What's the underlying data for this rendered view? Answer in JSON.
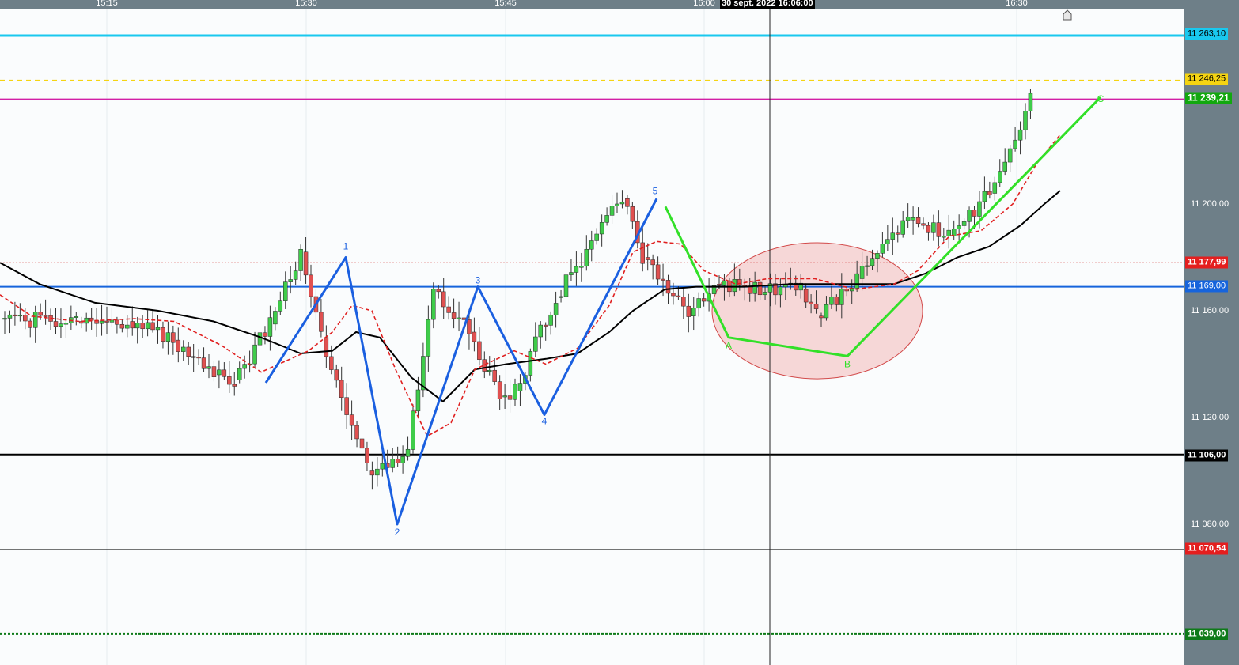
{
  "timebar": {
    "labels": [
      "15:15",
      "15:30",
      "15:45",
      "16:00",
      "16:30"
    ],
    "crosshair_time": "30 sept. 2022 16:06:00"
  },
  "axis": {
    "ticks": [
      "11 200,00",
      "11 160,00",
      "11 120,00",
      "11 080,00"
    ]
  },
  "levels": [
    {
      "label": "11 263,10",
      "value": 11263.1,
      "color": "#19c8ee",
      "label_bg": "#19c8ee",
      "label_fg": "#000000",
      "style": "solid"
    },
    {
      "label": "11 246,25",
      "value": 11246.25,
      "color": "#f5d412",
      "label_bg": "#f5d412",
      "label_fg": "#000000",
      "style": "dashed"
    },
    {
      "label": "11 239,21",
      "value": 11239.21,
      "color": "#d21fa5",
      "label_bg": "#11a80e",
      "label_fg": "#ffffff",
      "style": "solid"
    },
    {
      "label": "11 177,99",
      "value": 11177.99,
      "color": "#d23a3a",
      "label_bg": "#e41e1e",
      "label_fg": "#ffffff",
      "style": "dotted"
    },
    {
      "label": "11 169,00",
      "value": 11169.0,
      "color": "#1664dc",
      "label_bg": "#1664dc",
      "label_fg": "#ffffff",
      "style": "solid"
    },
    {
      "label": "11 106,00",
      "value": 11106.0,
      "color": "#000000",
      "label_bg": "#000000",
      "label_fg": "#ffffff",
      "style": "solid"
    },
    {
      "label": "11 070,54",
      "value": 11070.54,
      "color": "#222222",
      "label_bg": "#e41e1e",
      "label_fg": "#ffffff",
      "style": "thin"
    },
    {
      "label": "11 039,00",
      "value": 11039.0,
      "color": "#0e7a19",
      "label_bg": "#0e7a19",
      "label_fg": "#ffffff",
      "style": "dotted"
    }
  ],
  "wave_labels": {
    "blue": [
      "1",
      "2",
      "3",
      "4",
      "5"
    ],
    "green": [
      "A",
      "B",
      "C"
    ]
  },
  "colors": {
    "up_candle": "#3fcc4a",
    "down_candle": "#e05050",
    "blue_wave": "#1a5fe0",
    "green_wave": "#32e028",
    "sma_fast": "#e02020",
    "sma_slow": "#000000",
    "ellipse_fill": "#f2b8b8",
    "ellipse_stroke": "#d24a4a"
  },
  "chart_data": {
    "type": "candlestick",
    "ylim": [
      11022,
      11285
    ],
    "x_axis_ticks": [
      "15:15",
      "15:30",
      "15:45",
      "16:00",
      "16:30"
    ],
    "y_axis_ticks": [
      11200,
      11160,
      11120,
      11080
    ],
    "segments": [
      {
        "from": 11157,
        "to": 11156,
        "n": 15,
        "seed": 1
      },
      {
        "from": 11156,
        "to": 11156,
        "n": 10,
        "seed": 2
      },
      {
        "from": 11156,
        "to": 11149,
        "n": 9,
        "seed": 3
      },
      {
        "from": 11149,
        "to": 11136,
        "n": 8,
        "seed": 4
      },
      {
        "from": 11136,
        "to": 11134,
        "n": 4,
        "seed": 5
      },
      {
        "from": 11134,
        "to": 11155,
        "n": 7,
        "seed": 6
      },
      {
        "from": 11155,
        "to": 11182,
        "n": 6,
        "seed": 7
      },
      {
        "from": 11182,
        "to": 11150,
        "n": 4,
        "seed": 8
      },
      {
        "from": 11150,
        "to": 11100,
        "n": 9,
        "seed": 9
      },
      {
        "from": 11100,
        "to": 11108,
        "n": 8,
        "seed": 10
      },
      {
        "from": 11108,
        "to": 11168,
        "n": 5,
        "seed": 11
      },
      {
        "from": 11168,
        "to": 11152,
        "n": 7,
        "seed": 12
      },
      {
        "from": 11152,
        "to": 11128,
        "n": 6,
        "seed": 13
      },
      {
        "from": 11128,
        "to": 11130,
        "n": 3,
        "seed": 14
      },
      {
        "from": 11130,
        "to": 11165,
        "n": 8,
        "seed": 15
      },
      {
        "from": 11165,
        "to": 11202,
        "n": 13,
        "seed": 16
      },
      {
        "from": 11202,
        "to": 11180,
        "n": 4,
        "seed": 17
      },
      {
        "from": 11180,
        "to": 11158,
        "n": 9,
        "seed": 18
      },
      {
        "from": 11158,
        "to": 11170,
        "n": 5,
        "seed": 19
      },
      {
        "from": 11170,
        "to": 11168,
        "n": 17,
        "seed": 20
      },
      {
        "from": 11168,
        "to": 11158,
        "n": 3,
        "seed": 21
      },
      {
        "from": 11158,
        "to": 11172,
        "n": 8,
        "seed": 22
      },
      {
        "from": 11172,
        "to": 11194,
        "n": 10,
        "seed": 23
      },
      {
        "from": 11194,
        "to": 11188,
        "n": 8,
        "seed": 24
      },
      {
        "from": 11188,
        "to": 11204,
        "n": 8,
        "seed": 25
      },
      {
        "from": 11204,
        "to": 11239,
        "n": 8,
        "seed": 26
      }
    ],
    "sma_fast": [
      [
        0,
        11166
      ],
      [
        40,
        11158
      ],
      [
        100,
        11156
      ],
      [
        170,
        11157
      ],
      [
        220,
        11156
      ],
      [
        280,
        11147
      ],
      [
        330,
        11137
      ],
      [
        390,
        11145
      ],
      [
        420,
        11152
      ],
      [
        445,
        11162
      ],
      [
        470,
        11160
      ],
      [
        500,
        11138
      ],
      [
        540,
        11113
      ],
      [
        570,
        11118
      ],
      [
        600,
        11138
      ],
      [
        650,
        11145
      ],
      [
        690,
        11140
      ],
      [
        730,
        11146
      ],
      [
        770,
        11162
      ],
      [
        800,
        11182
      ],
      [
        830,
        11186
      ],
      [
        860,
        11185
      ],
      [
        890,
        11175
      ],
      [
        930,
        11170
      ],
      [
        970,
        11172
      ],
      [
        1030,
        11172
      ],
      [
        1080,
        11168
      ],
      [
        1130,
        11170
      ],
      [
        1160,
        11175
      ],
      [
        1200,
        11188
      ],
      [
        1240,
        11190
      ],
      [
        1280,
        11200
      ],
      [
        1310,
        11215
      ],
      [
        1340,
        11226
      ]
    ],
    "sma_slow": [
      [
        0,
        11178
      ],
      [
        50,
        11170
      ],
      [
        120,
        11163
      ],
      [
        200,
        11160
      ],
      [
        270,
        11156
      ],
      [
        330,
        11150
      ],
      [
        380,
        11144
      ],
      [
        420,
        11145
      ],
      [
        450,
        11152
      ],
      [
        480,
        11150
      ],
      [
        520,
        11135
      ],
      [
        560,
        11126
      ],
      [
        600,
        11138
      ],
      [
        640,
        11140
      ],
      [
        690,
        11142
      ],
      [
        730,
        11144
      ],
      [
        770,
        11152
      ],
      [
        800,
        11160
      ],
      [
        840,
        11168
      ],
      [
        880,
        11169
      ],
      [
        940,
        11169
      ],
      [
        1000,
        11170
      ],
      [
        1060,
        11170
      ],
      [
        1130,
        11170
      ],
      [
        1170,
        11174
      ],
      [
        1210,
        11180
      ],
      [
        1250,
        11184
      ],
      [
        1290,
        11192
      ],
      [
        1320,
        11200
      ],
      [
        1340,
        11205
      ]
    ],
    "blue_wave": [
      [
        336,
        11133
      ],
      [
        437,
        11180
      ],
      [
        502,
        11080
      ],
      [
        604,
        11169
      ],
      [
        688,
        11121
      ],
      [
        830,
        11202
      ]
    ],
    "green_wave": [
      [
        841,
        11199
      ],
      [
        921,
        11150
      ],
      [
        1071,
        11143
      ],
      [
        1391,
        11240
      ]
    ],
    "ellipse": {
      "cx": 1033,
      "cy_value": 11160,
      "rx": 133,
      "ry_value_half": 25.5
    }
  }
}
